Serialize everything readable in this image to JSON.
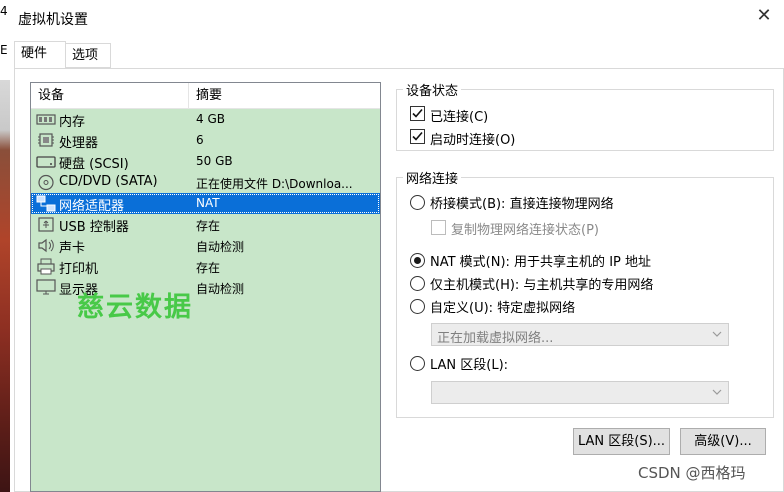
{
  "window": {
    "title": "虚拟机设置",
    "close_glyph": "✕"
  },
  "background": {
    "glyph_top": "4",
    "glyph_mid": "E"
  },
  "tabs": [
    {
      "label": "硬件"
    },
    {
      "label": "选项"
    }
  ],
  "device_list": {
    "columns": [
      "设备",
      "摘要"
    ],
    "rows": [
      {
        "name": "内存",
        "summary": "4 GB",
        "icon": "memory-icon"
      },
      {
        "name": "处理器",
        "summary": "6",
        "icon": "processor-icon"
      },
      {
        "name": "硬盘 (SCSI)",
        "summary": "50 GB",
        "icon": "hard-disk-icon"
      },
      {
        "name": "CD/DVD (SATA)",
        "summary": "正在使用文件 D:\\Downloa...",
        "icon": "cd-dvd-icon"
      },
      {
        "name": "网络适配器",
        "summary": "NAT",
        "icon": "network-adapter-icon",
        "selected": true
      },
      {
        "name": "USB 控制器",
        "summary": "存在",
        "icon": "usb-icon"
      },
      {
        "name": "声卡",
        "summary": "自动检测",
        "icon": "speaker-icon"
      },
      {
        "name": "打印机",
        "summary": "存在",
        "icon": "printer-icon"
      },
      {
        "name": "显示器",
        "summary": "自动检测",
        "icon": "monitor-icon"
      }
    ]
  },
  "watermark": "慈云数据",
  "device_status": {
    "title": "设备状态",
    "connected": {
      "label": "已连接(C)",
      "checked": true
    },
    "connect_on_power_on": {
      "label": "启动时连接(O)",
      "checked": true
    }
  },
  "network_connection": {
    "title": "网络连接",
    "bridged": {
      "label": "桥接模式(B): 直接连接物理网络",
      "selected": false
    },
    "replicate": {
      "label": "复制物理网络连接状态(P)",
      "checked": false,
      "disabled": true
    },
    "nat": {
      "label": "NAT 模式(N): 用于共享主机的 IP 地址",
      "selected": true
    },
    "host_only": {
      "label": "仅主机模式(H): 与主机共享的专用网络",
      "selected": false
    },
    "custom": {
      "label": "自定义(U): 特定虚拟网络",
      "selected": false
    },
    "custom_select": {
      "value": "正在加载虚拟网络..."
    },
    "lan_segment": {
      "label": "LAN 区段(L):",
      "selected": false
    },
    "lan_select": {
      "value": ""
    }
  },
  "buttons": {
    "lan_segments": "LAN 区段(S)...",
    "advanced": "高级(V)..."
  },
  "footer_watermark": "CSDN @西格玛"
}
